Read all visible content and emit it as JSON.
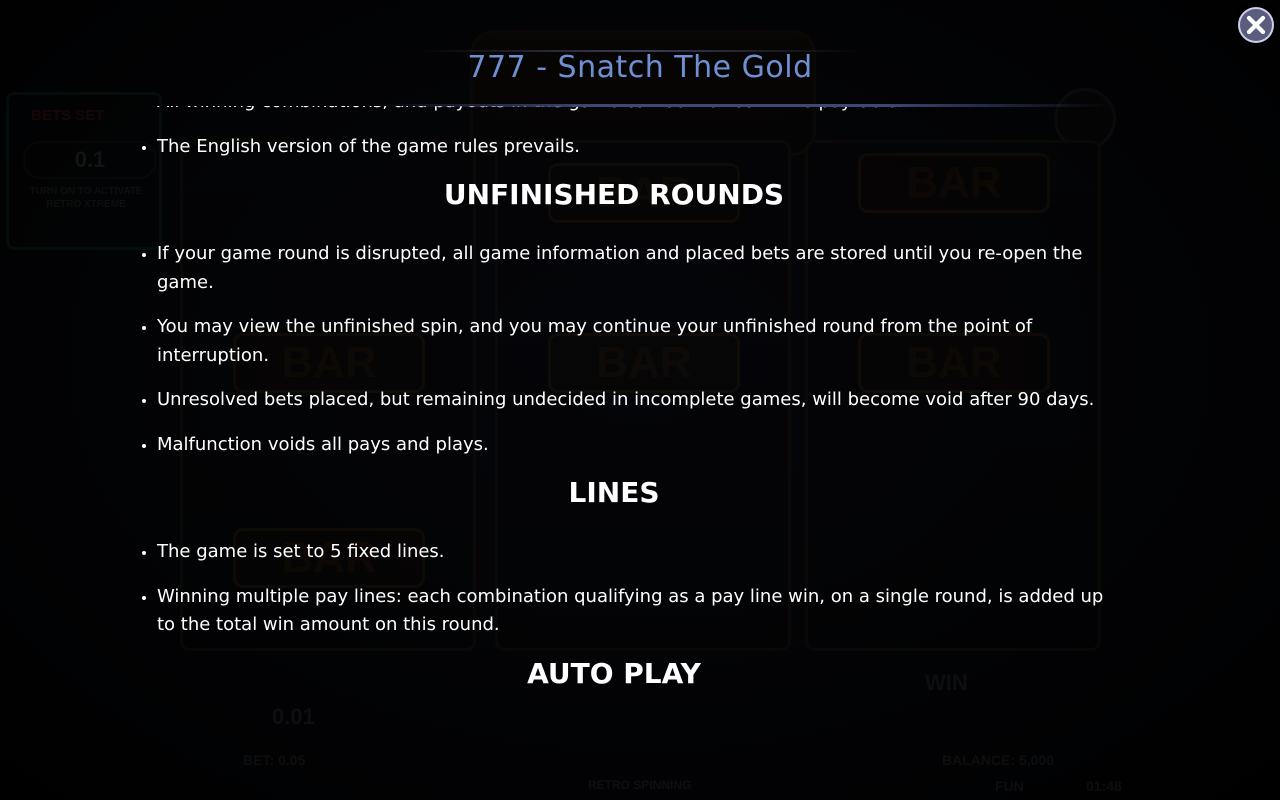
{
  "background_game": {
    "retro_panel": {
      "bet_tag": "BETS SET",
      "bet_value": "0.1",
      "hint": "TURN ON TO ACTIVATE RETRO XTREME"
    },
    "reel_symbols": [
      "BAR",
      "BAR",
      "BAR",
      "BAR",
      "BAR",
      "BAR"
    ],
    "bottom": {
      "line_bet_value": "0.01",
      "bet": "BET: 0.05",
      "win_label": "WIN",
      "balance": "BALANCE: 5,000",
      "mode": "FUN",
      "clock": "01:48",
      "retro_spinning": "RETRO SPINNING"
    }
  },
  "dialog": {
    "title": "777 - Snatch The Gold",
    "close_icon": "close-x-icon",
    "accent_color": "#6f8fd4"
  },
  "rules": {
    "intro_items": [
      "All winning combinations, and payouts in the game can be viewed in the paytable.",
      "The English version of the game rules prevails."
    ],
    "sections": [
      {
        "title": "UNFINISHED ROUNDS",
        "items": [
          "If your game round is disrupted, all game information and placed bets are stored until you re-open the game.",
          "You may view the unfinished spin, and you may continue your unfinished round from the point of interruption.",
          "Unresolved bets placed, but remaining undecided in incomplete games, will become void after 90 days.",
          "Malfunction voids all pays and plays."
        ]
      },
      {
        "title": "LINES",
        "items": [
          "The game is set to 5 fixed lines.",
          "Winning multiple pay lines: each combination qualifying as a pay line win, on a single round, is added up to the total win amount on this round."
        ]
      },
      {
        "title": "AUTO PLAY",
        "items": []
      }
    ]
  }
}
